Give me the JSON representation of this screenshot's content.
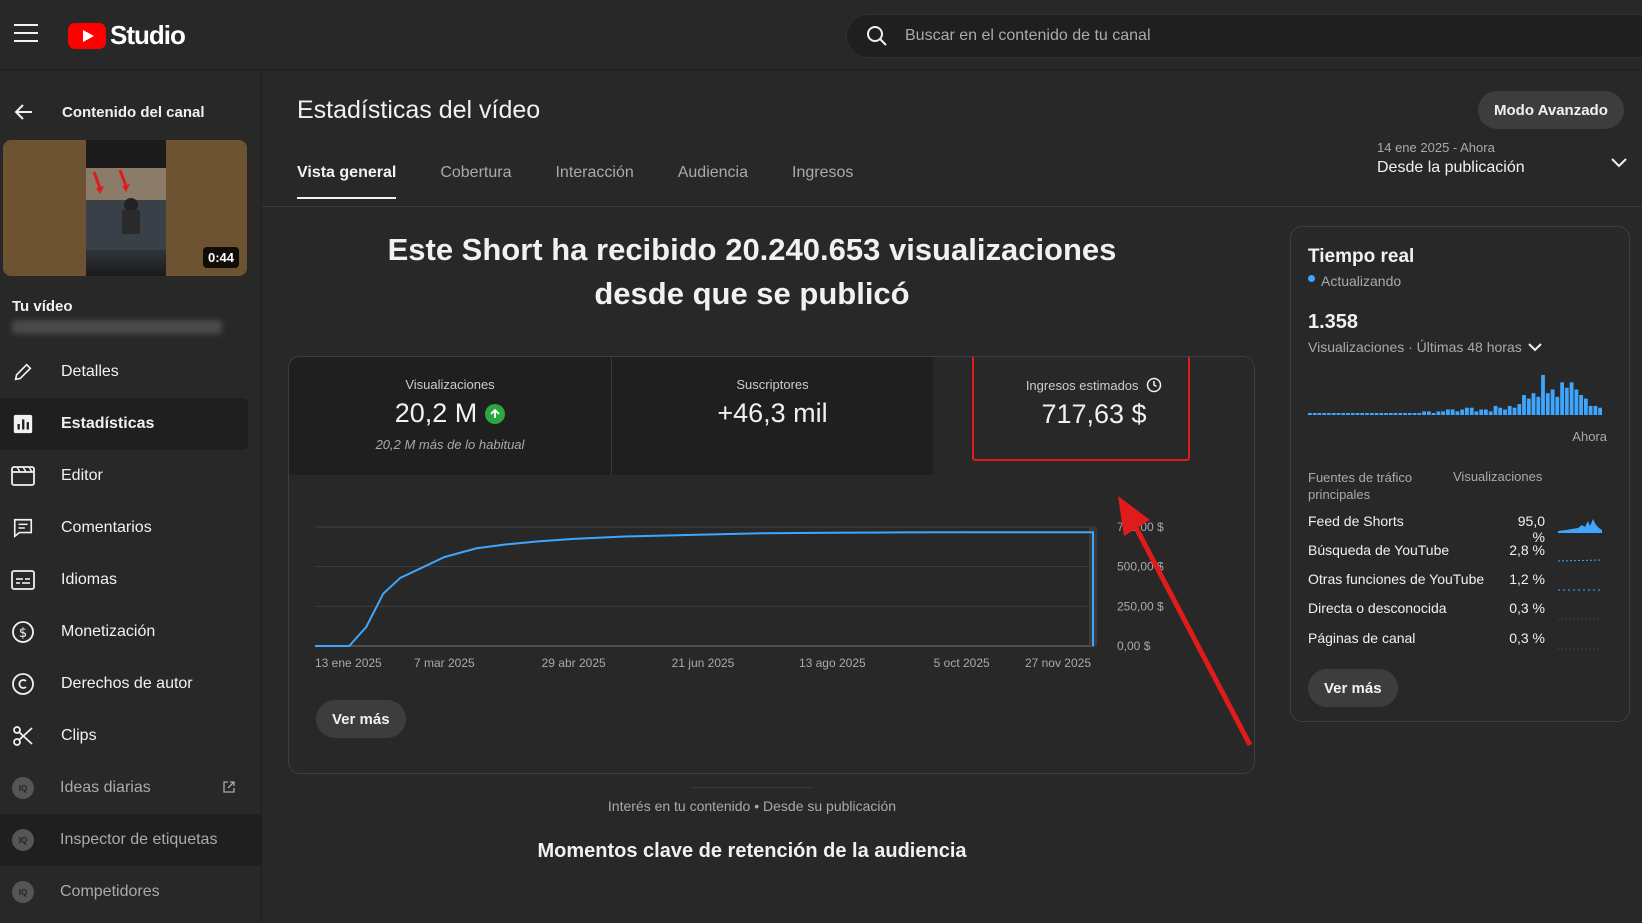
{
  "header": {
    "logo_text": "Studio",
    "search_placeholder": "Buscar en el contenido de tu canal"
  },
  "sidebar": {
    "back_label": "Contenido del canal",
    "thumbnail_duration": "0:44",
    "your_video_label": "Tu vídeo",
    "items": [
      {
        "label": "Detalles",
        "icon": "pencil-icon"
      },
      {
        "label": "Estadísticas",
        "icon": "analytics-icon",
        "active": true
      },
      {
        "label": "Editor",
        "icon": "film-icon"
      },
      {
        "label": "Comentarios",
        "icon": "comment-icon"
      },
      {
        "label": "Idiomas",
        "icon": "subtitles-icon"
      },
      {
        "label": "Monetización",
        "icon": "dollar-icon"
      },
      {
        "label": "Derechos de autor",
        "icon": "copyright-icon"
      },
      {
        "label": "Clips",
        "icon": "scissors-icon"
      },
      {
        "label": "Ideas diarias",
        "icon": "vidiq-icon"
      },
      {
        "label": "Inspector de etiquetas",
        "icon": "vidiq-icon"
      },
      {
        "label": "Competidores",
        "icon": "vidiq-icon"
      }
    ]
  },
  "main": {
    "page_title": "Estadísticas del vídeo",
    "mode_button": "Modo Avanzado",
    "tabs": [
      {
        "label": "Vista general",
        "active": true
      },
      {
        "label": "Cobertura"
      },
      {
        "label": "Interacción"
      },
      {
        "label": "Audiencia"
      },
      {
        "label": "Ingresos"
      }
    ],
    "date_range": {
      "range": "14 ene 2025 - Ahora",
      "label": "Desde la publicación"
    },
    "headline": "Este Short ha recibido 20.240.653 visualizaciones desde que se publicó",
    "metrics": [
      {
        "label": "Visualizaciones",
        "value": "20,2 M",
        "sub": "20,2 M más de lo habitual"
      },
      {
        "label": "Suscriptores",
        "value": "+46,3 mil"
      },
      {
        "label": "Ingresos estimados",
        "value": "717,63 $"
      }
    ],
    "see_more": "Ver más",
    "interest_text": "Interés en tu contenido • Desde su publicación",
    "retention_title": "Momentos clave de retención de la audiencia"
  },
  "realtime": {
    "title": "Tiempo real",
    "updating": "Actualizando",
    "count": "1.358",
    "subtitle": "Visualizaciones · Últimas 48 horas",
    "bars": [
      1,
      1,
      1,
      1,
      1,
      1,
      1,
      1,
      1,
      1,
      1,
      1,
      1,
      1,
      1,
      1,
      1,
      1,
      1,
      1,
      1,
      1,
      1,
      1,
      2,
      2,
      1,
      2,
      2,
      3,
      3,
      2,
      3,
      4,
      4,
      2,
      3,
      3,
      2,
      5,
      4,
      3,
      5,
      4,
      6,
      11,
      9,
      12,
      10,
      22,
      12,
      14,
      10,
      18,
      15,
      18,
      14,
      11,
      9,
      5,
      5,
      4
    ],
    "now_label": "Ahora",
    "sources_header": "Fuentes de tráfico principales",
    "views_header": "Visualizaciones",
    "sources": [
      {
        "name": "Feed de Shorts",
        "pct": "95,0 %"
      },
      {
        "name": "Búsqueda de YouTube",
        "pct": "2,8 %"
      },
      {
        "name": "Otras funciones de YouTube",
        "pct": "1,2 %"
      },
      {
        "name": "Directa o desconocida",
        "pct": "0,3 %"
      },
      {
        "name": "Páginas de canal",
        "pct": "0,3 %"
      }
    ],
    "see_more": "Ver más"
  },
  "chart_data": {
    "type": "line",
    "title": "",
    "xlabel": "",
    "ylabel": "",
    "x_tick_labels": [
      "13 ene 2025",
      "7 mar 2025",
      "29 abr 2025",
      "21 jun 2025",
      "13 ago 2025",
      "5 oct 2025",
      "27 nov 2025"
    ],
    "y_tick_labels": [
      "0,00 $",
      "250,00 $",
      "500,00 $",
      "750,00 $"
    ],
    "ylim": [
      0,
      750
    ],
    "grid": true,
    "series": [
      {
        "values_x": [
          "2025-01-13",
          "2025-01-20",
          "2025-01-27",
          "2025-02-03",
          "2025-02-10",
          "2025-02-17",
          "2025-02-24",
          "2025-03-07",
          "2025-03-20",
          "2025-04-01",
          "2025-04-15",
          "2025-04-29",
          "2025-05-20",
          "2025-06-21",
          "2025-07-15",
          "2025-08-13",
          "2025-09-10",
          "2025-10-05",
          "2025-11-01",
          "2025-11-27",
          "2025-12-02"
        ],
        "values_y": [
          0,
          0,
          0,
          120,
          330,
          430,
          480,
          560,
          615,
          640,
          660,
          675,
          690,
          702,
          710,
          714,
          716,
          717,
          717,
          717,
          717
        ]
      }
    ]
  }
}
